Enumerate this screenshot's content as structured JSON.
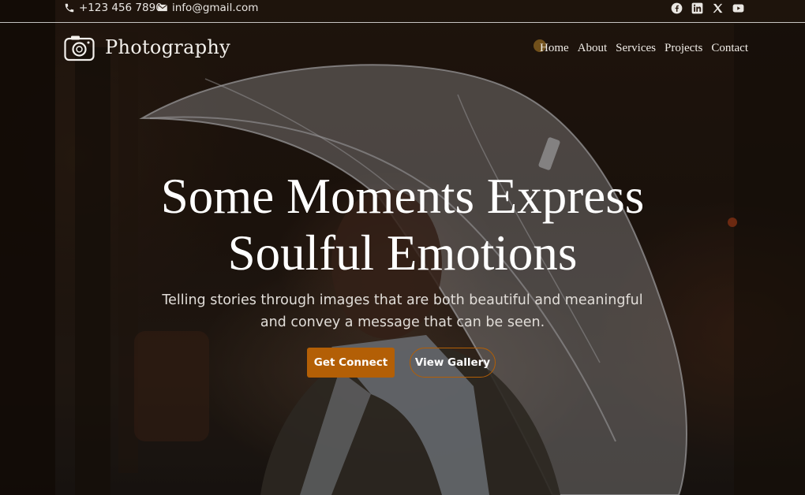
{
  "topbar": {
    "phone": "+123 456 7890",
    "email": "info@gmail.com",
    "socials": [
      "facebook-icon",
      "linkedin-icon",
      "x-icon",
      "youtube-icon"
    ]
  },
  "nav": {
    "brand": "Photography",
    "items": [
      "Home",
      "About",
      "Services",
      "Projects",
      "Contact"
    ]
  },
  "hero": {
    "headline_line1": "Some Moments Express",
    "headline_line2": "Soulful Emotions",
    "sub_line1": "Telling stories through images that are both beautiful and meaningful",
    "sub_line2": "and convey a message that can be seen.",
    "primary_button": "Get Connect",
    "secondary_button": "View Gallery"
  },
  "colors": {
    "accent": "#b35f06",
    "text": "#ffffff"
  }
}
